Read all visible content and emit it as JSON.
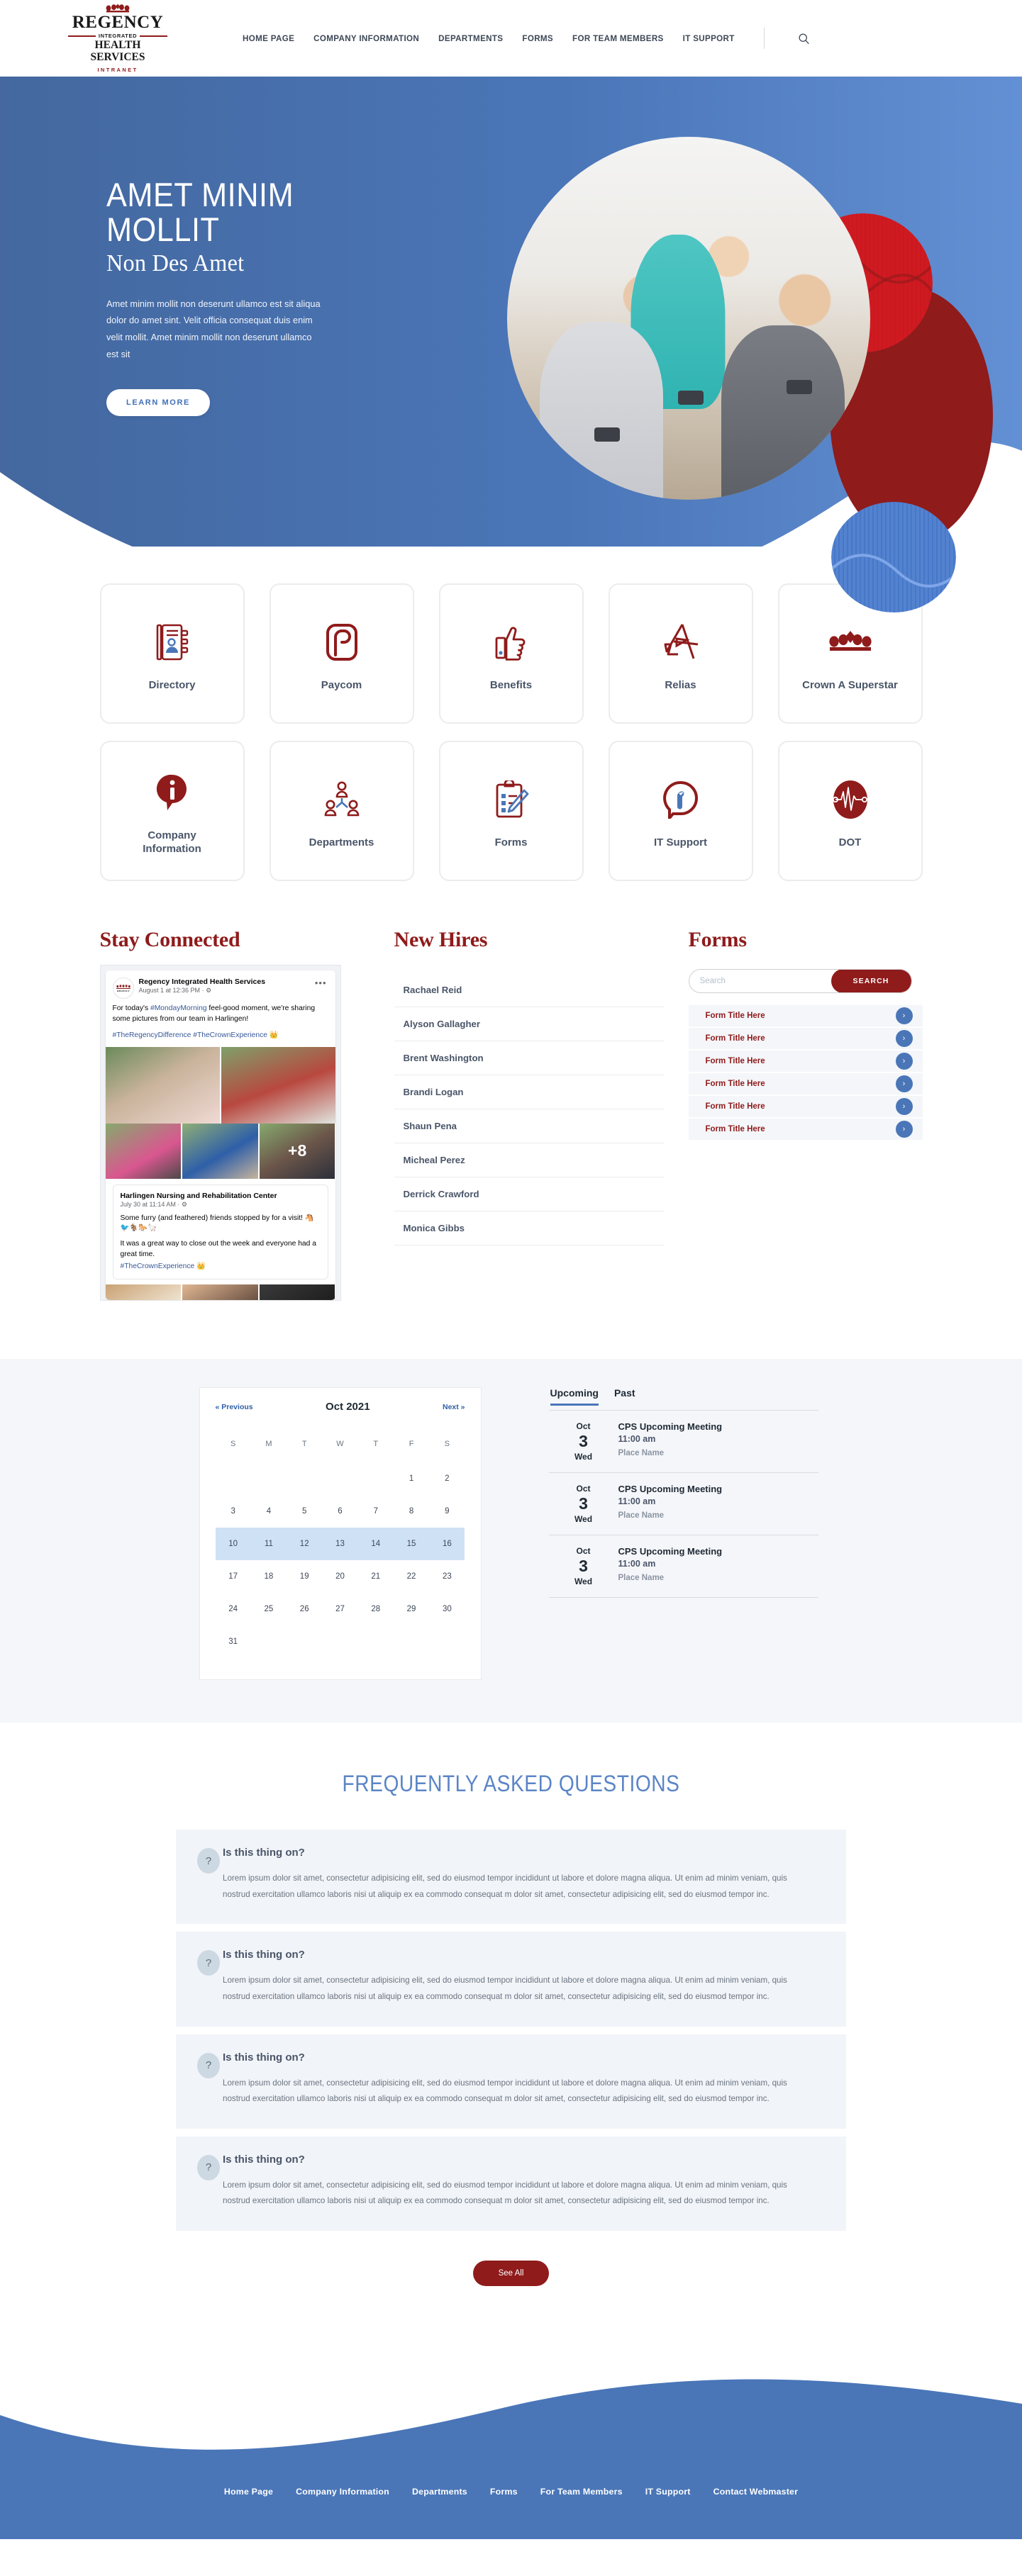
{
  "brand": {
    "logo_name": "REGENCY",
    "logo_rule": "INTEGRATED",
    "logo_sub": "HEALTH SERVICES",
    "logo_tag": "INTRANET",
    "accent_red": "#8f1b1b",
    "accent_blue": "#4a76b8",
    "hero_blue": "#4a76b8"
  },
  "nav": {
    "items": [
      {
        "label": "HOME PAGE"
      },
      {
        "label": "COMPANY INFORMATION"
      },
      {
        "label": "DEPARTMENTS"
      },
      {
        "label": "FORMS"
      },
      {
        "label": "FOR TEAM MEMBERS"
      },
      {
        "label": "IT SUPPORT"
      }
    ],
    "search_icon": "search-icon"
  },
  "hero": {
    "title": "AMET MINIM MOLLIT",
    "subtitle": "Non Des Amet",
    "body": "Amet minim mollit non deserunt ullamco est sit aliqua dolor do amet sint. Velit officia consequat duis enim velit mollit. Amet minim mollit non deserunt ullamco est sit",
    "button": "LEARN MORE"
  },
  "tiles": [
    {
      "label": "Directory",
      "icon": "address-book-icon"
    },
    {
      "label": "Paycom",
      "icon": "paycom-logo-icon"
    },
    {
      "label": "Benefits",
      "icon": "thumbs-up-icon"
    },
    {
      "label": "Relias",
      "icon": "relias-a-icon"
    },
    {
      "label": "Crown A Superstar",
      "icon": "crown-icon"
    },
    {
      "label": "Company Information",
      "icon": "info-pin-icon"
    },
    {
      "label": "Departments",
      "icon": "people-group-icon"
    },
    {
      "label": "Forms",
      "icon": "clipboard-pencil-icon"
    },
    {
      "label": "IT Support",
      "icon": "wrench-speech-icon"
    },
    {
      "label": "DOT",
      "icon": "heartbeat-oval-icon"
    }
  ],
  "stay_connected": {
    "heading": "Stay Connected",
    "post1": {
      "page": "Regency Integrated Health Services",
      "time": "August 1 at 12:36 PM",
      "body_before": "For today's ",
      "hashtag1": "#MondayMorning",
      "body_after": " feel-good moment, we're sharing some pictures from our team in Harlingen!",
      "tags": "#TheRegencyDifference #TheCrownExperience 👑",
      "more_count": "+8"
    },
    "post2": {
      "page": "Harlingen Nursing and Rehabilitation Center",
      "time": "July 30 at 11:14 AM",
      "line1": "Some furry (and feathered) friends stopped by for a visit! 🐴🐦🐐🐎🦙",
      "line2": "It was a great way to close out the week and everyone had a great time.",
      "tag": "#TheCrownExperience 👑"
    }
  },
  "new_hires": {
    "heading": "New Hires",
    "people": [
      "Rachael Reid",
      "Alyson Gallagher",
      "Brent Washington",
      "Brandi Logan",
      "Shaun Pena",
      "Micheal Perez",
      "Derrick Crawford",
      "Monica Gibbs"
    ]
  },
  "forms": {
    "heading": "Forms",
    "search_placeholder": "Search",
    "search_value": "",
    "search_button": "SEARCH",
    "rows": [
      {
        "title": "Form Title Here"
      },
      {
        "title": "Form Title Here"
      },
      {
        "title": "Form Title Here"
      },
      {
        "title": "Form Title Here"
      },
      {
        "title": "Form Title Here"
      },
      {
        "title": "Form Title Here"
      }
    ]
  },
  "calendar": {
    "prev": "« Previous",
    "month": "Oct 2021",
    "next": "Next »",
    "dow": [
      "S",
      "M",
      "T",
      "W",
      "T",
      "F",
      "S"
    ],
    "weeks": [
      [
        "",
        "",
        "",
        "",
        "",
        "1",
        "2"
      ],
      [
        "3",
        "4",
        "5",
        "6",
        "7",
        "8",
        "9"
      ],
      [
        "10",
        "11",
        "12",
        "13",
        "14",
        "15",
        "16"
      ],
      [
        "17",
        "18",
        "19",
        "20",
        "21",
        "22",
        "23"
      ],
      [
        "24",
        "25",
        "26",
        "27",
        "28",
        "29",
        "30"
      ],
      [
        "31",
        "",
        "",
        "",
        "",
        "",
        ""
      ]
    ],
    "highlighted_week_index": 2
  },
  "events": {
    "tabs": [
      {
        "label": "Upcoming",
        "active": true
      },
      {
        "label": "Past",
        "active": false
      }
    ],
    "items": [
      {
        "month": "Oct",
        "day": "3",
        "dow": "Wed",
        "title": "CPS Upcoming Meeting",
        "time": "11:00 am",
        "place": "Place Name"
      },
      {
        "month": "Oct",
        "day": "3",
        "dow": "Wed",
        "title": "CPS Upcoming Meeting",
        "time": "11:00 am",
        "place": "Place Name"
      },
      {
        "month": "Oct",
        "day": "3",
        "dow": "Wed",
        "title": "CPS Upcoming Meeting",
        "time": "11:00 am",
        "place": "Place Name"
      }
    ]
  },
  "faq": {
    "heading": "FREQUENTLY ASKED QUESTIONS",
    "icon": "?",
    "items": [
      {
        "question": "Is this thing on?",
        "answer": "Lorem ipsum dolor sit amet, consectetur adipisicing elit, sed do eiusmod tempor incididunt ut labore et dolore magna aliqua. Ut enim ad minim veniam, quis nostrud exercitation ullamco laboris nisi ut aliquip ex ea commodo consequat m dolor sit amet, consectetur adipisicing elit, sed do eiusmod tempor inc."
      },
      {
        "question": "Is this thing on?",
        "answer": "Lorem ipsum dolor sit amet, consectetur adipisicing elit, sed do eiusmod tempor incididunt ut labore et dolore magna aliqua. Ut enim ad minim veniam, quis nostrud exercitation ullamco laboris nisi ut aliquip ex ea commodo consequat m dolor sit amet, consectetur adipisicing elit, sed do eiusmod tempor inc."
      },
      {
        "question": "Is this thing on?",
        "answer": "Lorem ipsum dolor sit amet, consectetur adipisicing elit, sed do eiusmod tempor incididunt ut labore et dolore magna aliqua. Ut enim ad minim veniam, quis nostrud exercitation ullamco laboris nisi ut aliquip ex ea commodo consequat m dolor sit amet, consectetur adipisicing elit, sed do eiusmod tempor inc."
      },
      {
        "question": "Is this thing on?",
        "answer": "Lorem ipsum dolor sit amet, consectetur adipisicing elit, sed do eiusmod tempor incididunt ut labore et dolore magna aliqua. Ut enim ad minim veniam, quis nostrud exercitation ullamco laboris nisi ut aliquip ex ea commodo consequat m dolor sit amet, consectetur adipisicing elit, sed do eiusmod tempor inc."
      }
    ],
    "see_all": "See All"
  },
  "footer": {
    "links": [
      "Home Page",
      "Company Information",
      "Departments",
      "Forms",
      "For Team Members",
      "IT Support",
      "Contact Webmaster"
    ]
  }
}
